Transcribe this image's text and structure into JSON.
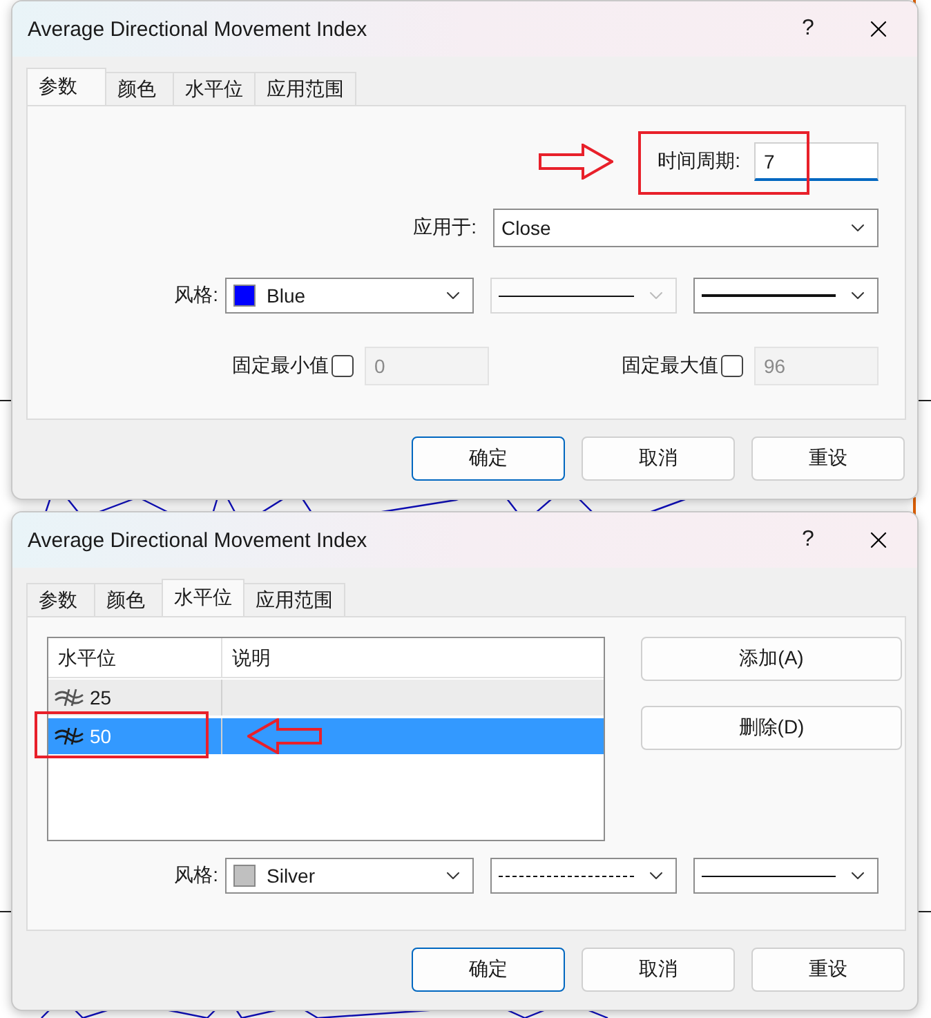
{
  "dialogs": [
    {
      "kind": "parameters",
      "title": "Average Directional Movement Index",
      "help": "?",
      "tabs": [
        {
          "label": "参数",
          "selected": true
        },
        {
          "label": "颜色",
          "selected": false
        },
        {
          "label": "水平位",
          "selected": false
        },
        {
          "label": "应用范围",
          "selected": false
        }
      ],
      "period": {
        "label": "时间周期:",
        "value": "7"
      },
      "apply_to": {
        "label": "应用于:",
        "value": "Close"
      },
      "style": {
        "label": "风格:",
        "color_name": "Blue",
        "color": "#0000ff",
        "dashed": false,
        "line_style_disabled": true,
        "thick": true
      },
      "fixed_min": {
        "label": "固定最小值",
        "checked": false,
        "value": "0",
        "disabled": true
      },
      "fixed_max": {
        "label": "固定最大值",
        "checked": false,
        "value": "96",
        "disabled": true
      },
      "buttons": [
        {
          "label": "确定",
          "default": true
        },
        {
          "label": "取消",
          "default": false
        },
        {
          "label": "重设",
          "default": false
        }
      ]
    },
    {
      "kind": "levels",
      "title": "Average Directional Movement Index",
      "help": "?",
      "tabs": [
        {
          "label": "参数",
          "selected": false
        },
        {
          "label": "颜色",
          "selected": false
        },
        {
          "label": "水平位",
          "selected": true
        },
        {
          "label": "应用范围",
          "selected": false
        }
      ],
      "levels_table": {
        "columns": [
          "水平位",
          "说明"
        ],
        "rows": [
          {
            "value": "25",
            "selected": false
          },
          {
            "value": "50",
            "selected": true
          }
        ]
      },
      "side_buttons": [
        "添加(A)",
        "删除(D)"
      ],
      "style": {
        "label": "风格:",
        "color_name": "Silver",
        "color": "#c0c0c0",
        "dashed": true,
        "line_style_disabled": false,
        "thick": false
      },
      "buttons": [
        {
          "label": "确定",
          "default": true
        },
        {
          "label": "取消",
          "default": false
        },
        {
          "label": "重设",
          "default": false
        }
      ]
    }
  ]
}
